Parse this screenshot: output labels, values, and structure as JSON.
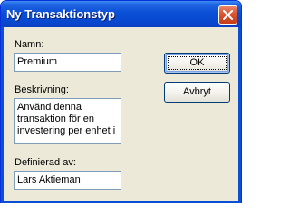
{
  "window": {
    "title": "Ny Transaktionstyp"
  },
  "form": {
    "name_label": "Namn:",
    "name_value": "Premium",
    "description_label": "Beskrivning:",
    "description_value": "Använd denna transaktion för en investering per enhet i",
    "defined_by_label": "Definierad av:",
    "defined_by_value": "Lars Aktieman"
  },
  "buttons": {
    "ok_label": "OK",
    "cancel_label": "Avbryt"
  },
  "icons": {
    "close": "close-icon"
  },
  "colors": {
    "titlebar": "#0a4fd6",
    "close_button": "#d9542f",
    "dialog_background": "#ece9d8",
    "field_border": "#7f9db9"
  }
}
